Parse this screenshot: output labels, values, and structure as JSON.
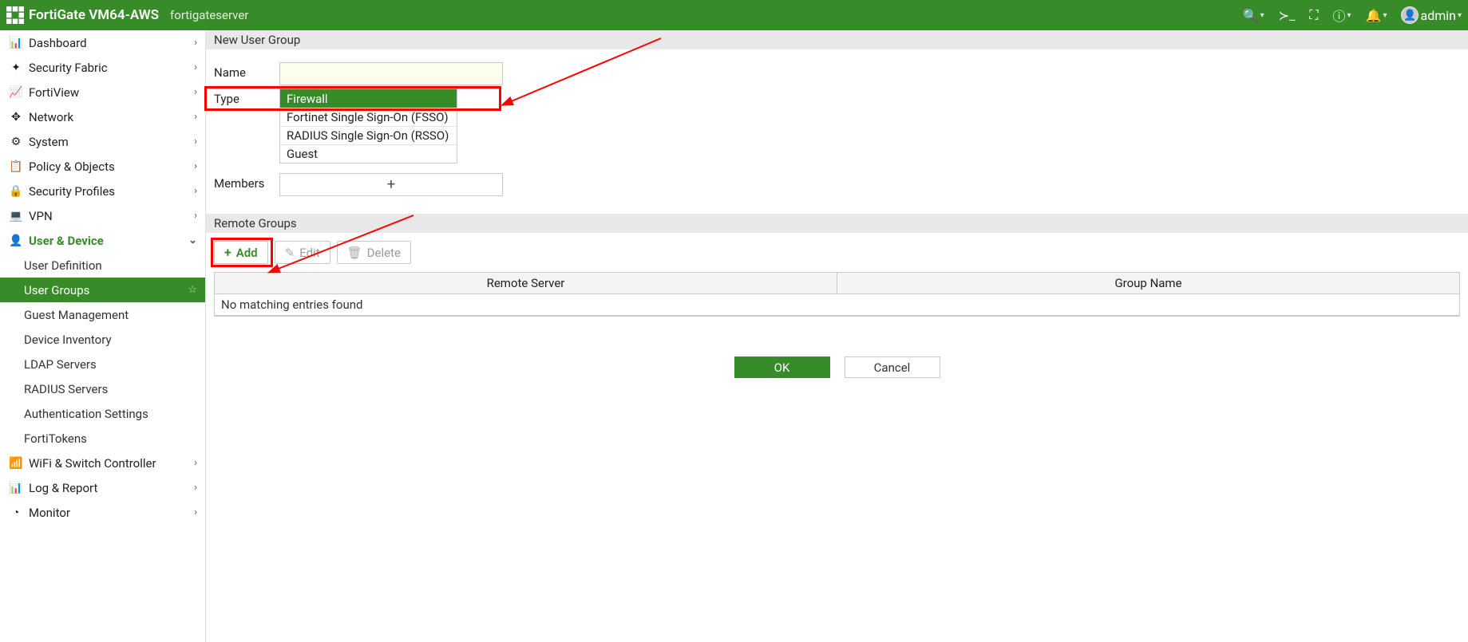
{
  "topbar": {
    "product": "FortiGate VM64-AWS",
    "hostname": "fortigateserver",
    "username": "admin"
  },
  "sidebar": {
    "items": [
      {
        "label": "Dashboard",
        "icon": "dashboard"
      },
      {
        "label": "Security Fabric",
        "icon": "fabric"
      },
      {
        "label": "FortiView",
        "icon": "chart"
      },
      {
        "label": "Network",
        "icon": "net"
      },
      {
        "label": "System",
        "icon": "gear"
      },
      {
        "label": "Policy & Objects",
        "icon": "policy"
      },
      {
        "label": "Security Profiles",
        "icon": "lock"
      },
      {
        "label": "VPN",
        "icon": "vpn"
      },
      {
        "label": "User & Device",
        "icon": "user",
        "active": true
      },
      {
        "label": "WiFi & Switch Controller",
        "icon": "wifi"
      },
      {
        "label": "Log & Report",
        "icon": "log"
      },
      {
        "label": "Monitor",
        "icon": "monitor"
      }
    ],
    "subitems": [
      {
        "label": "User Definition"
      },
      {
        "label": "User Groups",
        "selected": true
      },
      {
        "label": "Guest Management"
      },
      {
        "label": "Device Inventory"
      },
      {
        "label": "LDAP Servers"
      },
      {
        "label": "RADIUS Servers"
      },
      {
        "label": "Authentication Settings"
      },
      {
        "label": "FortiTokens"
      }
    ]
  },
  "main": {
    "section_title": "New User Group",
    "form": {
      "name_label": "Name",
      "name_value": "",
      "type_label": "Type",
      "type_options": [
        "Firewall",
        "Fortinet Single Sign-On (FSSO)",
        "RADIUS Single Sign-On (RSSO)",
        "Guest"
      ],
      "type_selected": "Firewall",
      "members_label": "Members"
    },
    "remote": {
      "section_title": "Remote Groups",
      "add_label": "Add",
      "edit_label": "Edit",
      "delete_label": "Delete",
      "col_server": "Remote Server",
      "col_group": "Group Name",
      "empty_text": "No matching entries found"
    },
    "footer": {
      "ok": "OK",
      "cancel": "Cancel"
    }
  }
}
